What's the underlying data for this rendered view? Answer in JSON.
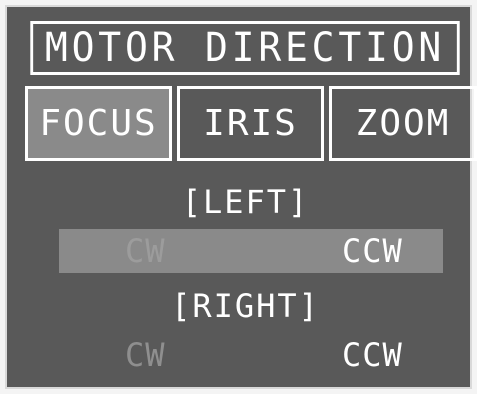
{
  "title": "MOTOR DIRECTION",
  "tabs": [
    {
      "label": "FOCUS",
      "active": true
    },
    {
      "label": "IRIS",
      "active": false
    },
    {
      "label": "ZOOM",
      "active": false
    }
  ],
  "sections": {
    "left": {
      "label": "[LEFT]",
      "options": {
        "cw": "CW",
        "ccw": "CCW"
      },
      "selected_option": "CCW",
      "row_highlighted": true
    },
    "right": {
      "label": "[RIGHT]",
      "options": {
        "cw": "CW",
        "ccw": "CCW"
      },
      "selected_option": "CCW",
      "row_highlighted": false
    }
  },
  "colors": {
    "panel_background": "#595959",
    "highlight": "#8a8a8a",
    "text": "#ffffff",
    "dim_text": "#8f8f8f"
  }
}
